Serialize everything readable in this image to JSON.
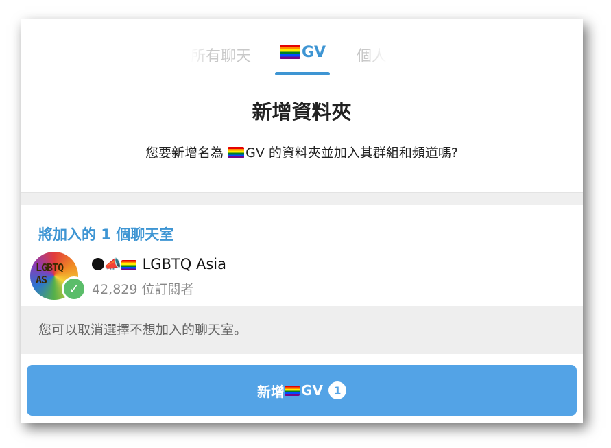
{
  "tabs": {
    "all_chats": "所有聊天",
    "folder": "GV",
    "personal": "個人"
  },
  "dialog": {
    "title": "新增資料夾",
    "desc_prefix": "您要新增名為 ",
    "desc_folder": "GV",
    "desc_suffix": " 的資料夾並加入其群組和頻道嗎?"
  },
  "section": {
    "header": "將加入的 1 個聊天室"
  },
  "chat": {
    "avatar_line1": "LGBTQ",
    "avatar_line2": "AS",
    "megaphone": "📣",
    "name": "LGBTQ Asia",
    "subscribers": "42,829 位訂閱者",
    "selected_mark": "✓"
  },
  "info": {
    "text": "您可以取消選擇不想加入的聊天室。"
  },
  "button": {
    "prefix": "新增 ",
    "folder": "GV",
    "count": "1"
  },
  "colors": {
    "accent": "#3e95d3",
    "button": "#53a3e6",
    "check": "#5bbd6a"
  }
}
